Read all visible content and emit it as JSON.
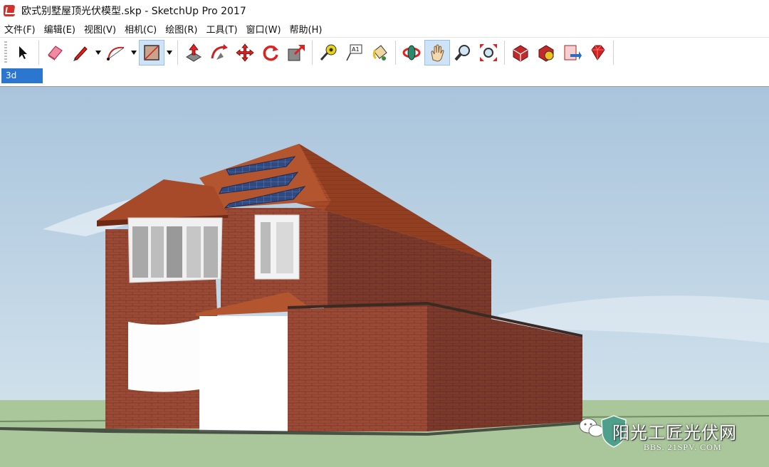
{
  "window": {
    "title": "欧式别墅屋顶光伏模型.skp - SketchUp Pro 2017"
  },
  "menu": {
    "items": [
      {
        "label": "文件(F)"
      },
      {
        "label": "编辑(E)"
      },
      {
        "label": "视图(V)"
      },
      {
        "label": "相机(C)"
      },
      {
        "label": "绘图(R)"
      },
      {
        "label": "工具(T)"
      },
      {
        "label": "窗口(W)"
      },
      {
        "label": "帮助(H)"
      }
    ]
  },
  "toolbar": {
    "tools": [
      {
        "icon": "select-arrow-icon"
      },
      {
        "icon": "eraser-icon"
      },
      {
        "icon": "pencil-line-icon"
      },
      {
        "icon": "arc-icon"
      },
      {
        "icon": "rectangle-shape-icon",
        "active": true
      },
      {
        "icon": "push-pull-icon"
      },
      {
        "icon": "follow-me-icon"
      },
      {
        "icon": "move-icon"
      },
      {
        "icon": "rotate-icon"
      },
      {
        "icon": "scale-icon"
      },
      {
        "icon": "tape-measure-icon"
      },
      {
        "icon": "text-label-icon",
        "text": "A1"
      },
      {
        "icon": "paint-bucket-icon"
      },
      {
        "icon": "orbit-icon"
      },
      {
        "icon": "pan-hand-icon",
        "active": true
      },
      {
        "icon": "zoom-icon"
      },
      {
        "icon": "zoom-extents-icon"
      },
      {
        "icon": "3d-warehouse-icon"
      },
      {
        "icon": "extension-warehouse-icon"
      },
      {
        "icon": "send-to-layout-icon"
      },
      {
        "icon": "ruby-console-icon"
      }
    ]
  },
  "vcb": {
    "value": "3d"
  },
  "watermark": {
    "text": "阳光工匠光伏网",
    "url": "BBS. 21SPV. COM"
  },
  "colors": {
    "sky_top": "#a9c4dc",
    "sky_bottom": "#d7e6ee",
    "ground": "#a9c79a",
    "brick": "#9b4a36",
    "roof": "#a64a2a",
    "solar": "#2f4a82",
    "selection": "#2b77cf"
  }
}
